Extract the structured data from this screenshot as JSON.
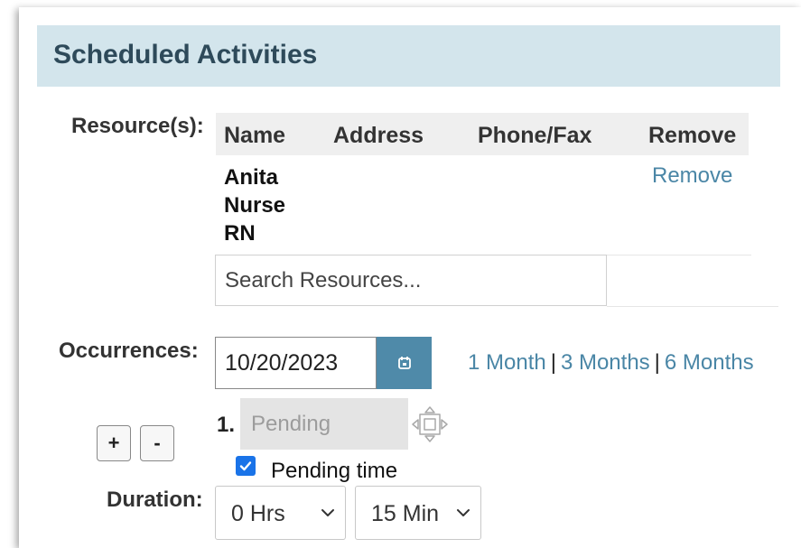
{
  "section": {
    "title": "Scheduled Activities"
  },
  "resources": {
    "label": "Resource(s):",
    "columns": [
      "Name",
      "Address",
      "Phone/Fax",
      "Remove"
    ],
    "rows": [
      {
        "name_lines": [
          "Anita",
          "Nurse",
          "RN"
        ],
        "address": "",
        "phone": "",
        "remove_label": "Remove"
      }
    ],
    "search_placeholder": "Search Resources..."
  },
  "occurrences": {
    "label": "Occurrences:",
    "date_value": "10/20/2023",
    "quick_links": [
      "1 Month",
      "3 Months",
      "6 Months"
    ],
    "separator": "|",
    "items": [
      {
        "number": "1.",
        "placeholder": "Pending",
        "pending_time_checked": true,
        "pending_time_label": "Pending time"
      }
    ],
    "add_label": "+",
    "remove_label": "-"
  },
  "duration": {
    "label": "Duration:",
    "hours_value": "0 Hrs",
    "minutes_value": "15 Min"
  },
  "colors": {
    "header_bg": "#d3e5ec",
    "header_text": "#2e4a5a",
    "link": "#4a86a6",
    "calendar_button": "#4f8aa9",
    "checkbox": "#1a73e8"
  },
  "icons": {
    "calendar": "calendar-icon",
    "move": "move-icon",
    "checkbox": "check-icon",
    "select": "chevron-down-icon"
  }
}
